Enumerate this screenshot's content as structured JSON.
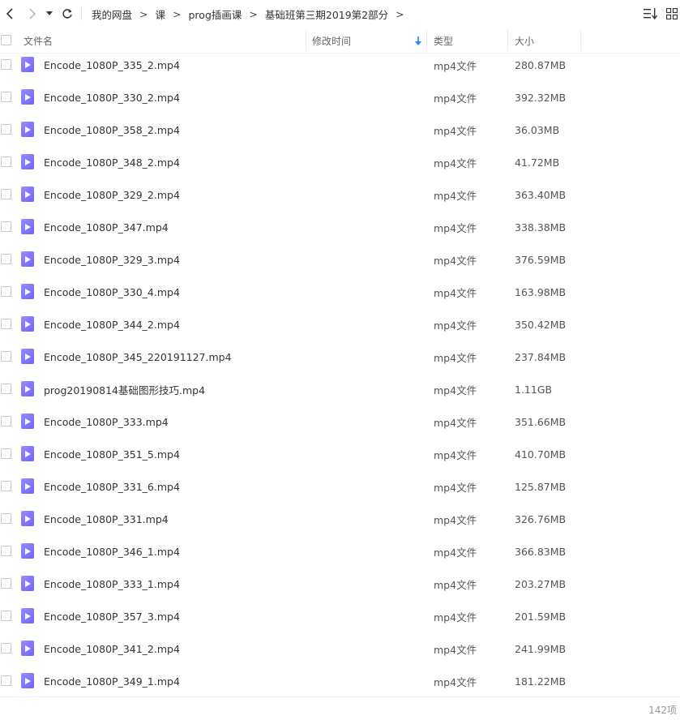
{
  "toolbar": {
    "back_icon": "chevron-left-icon",
    "forward_icon": "chevron-right-icon",
    "history_icon": "caret-down-icon",
    "refresh_icon": "refresh-icon",
    "breadcrumb": [
      "我的网盘",
      "课",
      "prog插画课",
      "基础班第三期2019第2部分"
    ],
    "crumb_sep": ">",
    "sort_icon": "sort-list-icon",
    "grid_icon": "grid-view-icon"
  },
  "columns": {
    "name": "文件名",
    "modified": "修改时间",
    "type": "类型",
    "size": "大小",
    "sort_indicator_color": "#1a8cff"
  },
  "files": [
    {
      "name": "Encode_1080P_335_2.mp4",
      "type": "mp4文件",
      "size": "280.87MB"
    },
    {
      "name": "Encode_1080P_330_2.mp4",
      "type": "mp4文件",
      "size": "392.32MB"
    },
    {
      "name": "Encode_1080P_358_2.mp4",
      "type": "mp4文件",
      "size": "36.03MB"
    },
    {
      "name": "Encode_1080P_348_2.mp4",
      "type": "mp4文件",
      "size": "41.72MB"
    },
    {
      "name": "Encode_1080P_329_2.mp4",
      "type": "mp4文件",
      "size": "363.40MB"
    },
    {
      "name": "Encode_1080P_347.mp4",
      "type": "mp4文件",
      "size": "338.38MB"
    },
    {
      "name": "Encode_1080P_329_3.mp4",
      "type": "mp4文件",
      "size": "376.59MB"
    },
    {
      "name": "Encode_1080P_330_4.mp4",
      "type": "mp4文件",
      "size": "163.98MB"
    },
    {
      "name": "Encode_1080P_344_2.mp4",
      "type": "mp4文件",
      "size": "350.42MB"
    },
    {
      "name": "Encode_1080P_345_220191127.mp4",
      "type": "mp4文件",
      "size": "237.84MB"
    },
    {
      "name": "prog20190814基础图形技巧.mp4",
      "type": "mp4文件",
      "size": "1.11GB"
    },
    {
      "name": "Encode_1080P_333.mp4",
      "type": "mp4文件",
      "size": "351.66MB"
    },
    {
      "name": "Encode_1080P_351_5.mp4",
      "type": "mp4文件",
      "size": "410.70MB"
    },
    {
      "name": "Encode_1080P_331_6.mp4",
      "type": "mp4文件",
      "size": "125.87MB"
    },
    {
      "name": "Encode_1080P_331.mp4",
      "type": "mp4文件",
      "size": "326.76MB"
    },
    {
      "name": "Encode_1080P_346_1.mp4",
      "type": "mp4文件",
      "size": "366.83MB"
    },
    {
      "name": "Encode_1080P_333_1.mp4",
      "type": "mp4文件",
      "size": "203.27MB"
    },
    {
      "name": "Encode_1080P_357_3.mp4",
      "type": "mp4文件",
      "size": "201.59MB"
    },
    {
      "name": "Encode_1080P_341_2.mp4",
      "type": "mp4文件",
      "size": "241.99MB"
    },
    {
      "name": "Encode_1080P_349_1.mp4",
      "type": "mp4文件",
      "size": "181.22MB"
    }
  ],
  "file_icon": "video-file-icon",
  "file_icon_color": "#7b6ff7",
  "footer": {
    "count": "142项"
  }
}
